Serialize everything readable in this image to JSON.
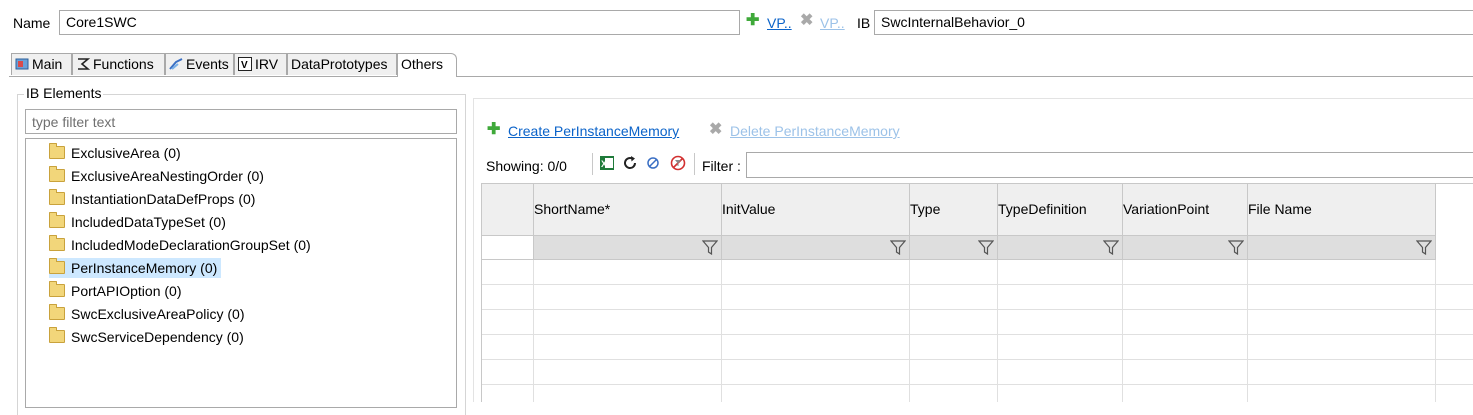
{
  "header": {
    "name_label": "Name",
    "name_value": "Core1SWC",
    "vp_add_label": "VP..",
    "vp_delete_label": "VP..",
    "ib_label": "IB",
    "ib_value": "SwcInternalBehavior_0"
  },
  "tabs": [
    {
      "label": "Main",
      "icon": "main-icon"
    },
    {
      "label": "Functions",
      "icon": "functions-icon"
    },
    {
      "label": "Events",
      "icon": "events-icon"
    },
    {
      "label": "IRV",
      "icon": "irv-icon"
    },
    {
      "label": "DataPrototypes",
      "icon": ""
    },
    {
      "label": "Others",
      "icon": "",
      "active": true
    }
  ],
  "ib_elements": {
    "title": "IB Elements",
    "filter_placeholder": "type filter text",
    "items": [
      {
        "label": "ExclusiveArea (0)"
      },
      {
        "label": "ExclusiveAreaNestingOrder (0)"
      },
      {
        "label": "InstantiationDataDefProps (0)"
      },
      {
        "label": "IncludedDataTypeSet (0)"
      },
      {
        "label": "IncludedModeDeclarationGroupSet (0)"
      },
      {
        "label": "PerInstanceMemory (0)",
        "selected": true
      },
      {
        "label": "PortAPIOption (0)"
      },
      {
        "label": "SwcExclusiveAreaPolicy (0)"
      },
      {
        "label": "SwcServiceDependency (0)"
      }
    ]
  },
  "detail": {
    "create_label": "Create PerInstanceMemory",
    "delete_label": "Delete PerInstanceMemory",
    "showing_label": "Showing: 0/0",
    "filter_label": "Filter :",
    "columns": [
      "ShortName*",
      "InitValue",
      "Type",
      "TypeDefinition",
      "VariationPoint",
      "File Name"
    ]
  },
  "colors": {
    "accent_link": "#0b63c9",
    "selection": "#cde8ff",
    "add_green": "#3fa93a"
  }
}
